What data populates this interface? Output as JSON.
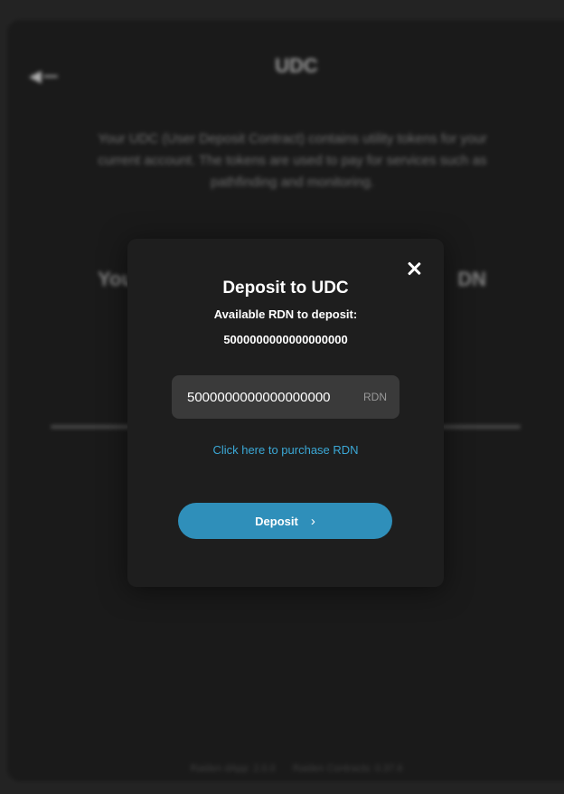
{
  "background": {
    "title": "UDC",
    "description": "Your UDC (User Deposit Contract) contains utility tokens for your current account. The tokens are used to pay for services such as pathfinding and monitoring.",
    "balance_left": "You",
    "balance_right": "DN",
    "footer": {
      "raiden_dapp": "Raiden dApp: 2.0.0",
      "raiden_contracts": "Raiden Contracts: 0.37.6"
    }
  },
  "modal": {
    "title": "Deposit to UDC",
    "available_label": "Available RDN to deposit:",
    "available_amount": "5000000000000000000",
    "input_value": "5000000000000000000",
    "input_unit": "RDN",
    "purchase_link": "Click here to purchase RDN",
    "deposit_button": "Deposit"
  },
  "colors": {
    "accent": "#2f8fba",
    "link": "#3ba8d6",
    "modal_bg": "#1e1e1e",
    "input_bg": "#3a3a3a"
  },
  "icons": {
    "close": "close-icon",
    "chevron": "chevron-right-icon",
    "back": "back-arrow-icon"
  }
}
